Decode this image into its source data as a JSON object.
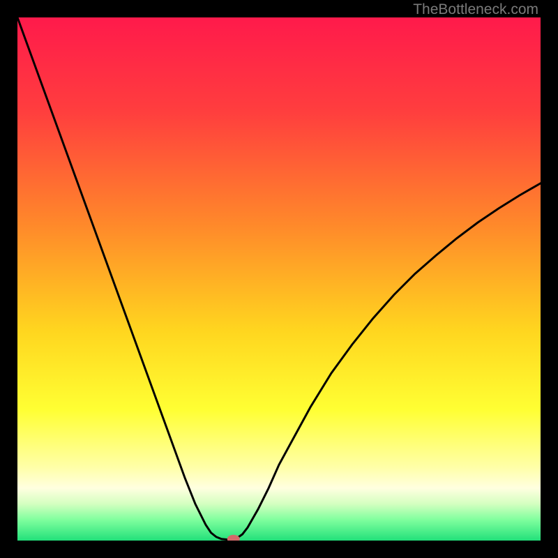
{
  "watermark": "TheBottleneck.com",
  "chart_data": {
    "type": "line",
    "title": "",
    "xlabel": "",
    "ylabel": "",
    "xlim": [
      0,
      100
    ],
    "ylim": [
      0,
      100
    ],
    "gradient_stops": [
      {
        "offset": 0.0,
        "color": "#ff1a4b"
      },
      {
        "offset": 0.18,
        "color": "#ff3e3e"
      },
      {
        "offset": 0.4,
        "color": "#ff8a2a"
      },
      {
        "offset": 0.6,
        "color": "#ffd61f"
      },
      {
        "offset": 0.75,
        "color": "#ffff33"
      },
      {
        "offset": 0.86,
        "color": "#ffffa8"
      },
      {
        "offset": 0.9,
        "color": "#ffffe0"
      },
      {
        "offset": 0.93,
        "color": "#d4ffc0"
      },
      {
        "offset": 0.96,
        "color": "#80ff9e"
      },
      {
        "offset": 1.0,
        "color": "#22e07a"
      }
    ],
    "series": [
      {
        "name": "bottleneck-curve",
        "x": [
          0.0,
          2,
          4,
          6,
          8,
          10,
          12,
          14,
          16,
          18,
          20,
          22,
          24,
          26,
          28,
          30,
          32,
          34,
          36,
          37,
          38,
          39,
          40,
          41,
          42,
          43,
          44,
          46,
          48,
          50,
          53,
          56,
          60,
          64,
          68,
          72,
          76,
          80,
          84,
          88,
          92,
          96,
          100
        ],
        "y": [
          100,
          94.5,
          89,
          83.5,
          78,
          72.5,
          67,
          61.5,
          56,
          50.5,
          45,
          39.5,
          34,
          28.5,
          23,
          17.5,
          12,
          7,
          3,
          1.5,
          0.7,
          0.3,
          0.2,
          0.2,
          0.5,
          1.2,
          2.5,
          6,
          10,
          14.5,
          20,
          25.5,
          32,
          37.5,
          42.5,
          47,
          51,
          54.5,
          57.8,
          60.8,
          63.5,
          66,
          68.3
        ]
      }
    ],
    "marker": {
      "x": 41.3,
      "y": 0.3,
      "color": "#d46a6a",
      "rx": 9,
      "ry": 6
    }
  }
}
